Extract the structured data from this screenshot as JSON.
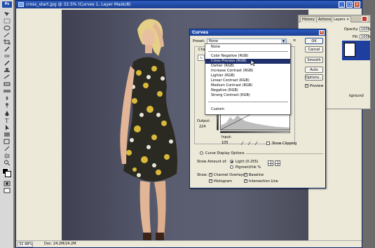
{
  "app": {
    "logo": "Ps"
  },
  "document": {
    "title": "cross_start.jpg @ 32.5% (Curves 1, Layer Mask/8)",
    "zoom": "32.48%",
    "doc_info": "Doc: 24.2M/24.2M"
  },
  "panel": {
    "tabs": [
      "History",
      "Actions",
      "Layers ×"
    ],
    "opacity_label": "Opacity:",
    "opacity_value": "100%",
    "fill_label": "Fill:",
    "fill_value": "100%",
    "background_label": "kground"
  },
  "curves": {
    "title": "Curves",
    "close": "×",
    "preset_label": "Preset:",
    "preset_value": "None",
    "channel_label": "Chann",
    "output_label": "Output:",
    "output_value": "224",
    "input_label": "Input:",
    "input_value": "105",
    "show_clipping": "Show Clipping",
    "display_options": "Curve Display Options",
    "show_amount_label": "Show Amount of:",
    "light_option": "Light (0-255)",
    "pigment_option": "Pigment/Ink %",
    "show_label": "Show:",
    "channel_overlays": "Channel Overlays",
    "baseline": "Baseline",
    "histogram": "Histogram",
    "intersection_line": "Intersection Line",
    "buttons": {
      "ok": "OK",
      "cancel": "Cancel",
      "smooth": "Smooth",
      "auto": "Auto",
      "options": "Options..."
    },
    "preview": "Preview"
  },
  "dropdown": {
    "items": [
      "None",
      "Color Negative (RGB)",
      "Cross Process (RGB)",
      "Darker (RGB)",
      "Increase Contrast (RGB)",
      "Lighter (RGB)",
      "Linear Contrast (RGB)",
      "Medium Contrast (RGB)",
      "Negative (RGB)",
      "Strong Contrast (RGB)",
      "Custom"
    ],
    "selected_index": 2
  },
  "colors": {
    "titlebar": "#1c3f94",
    "selection": "#1e2f6b",
    "canvas_bg": "#5a5d70"
  }
}
